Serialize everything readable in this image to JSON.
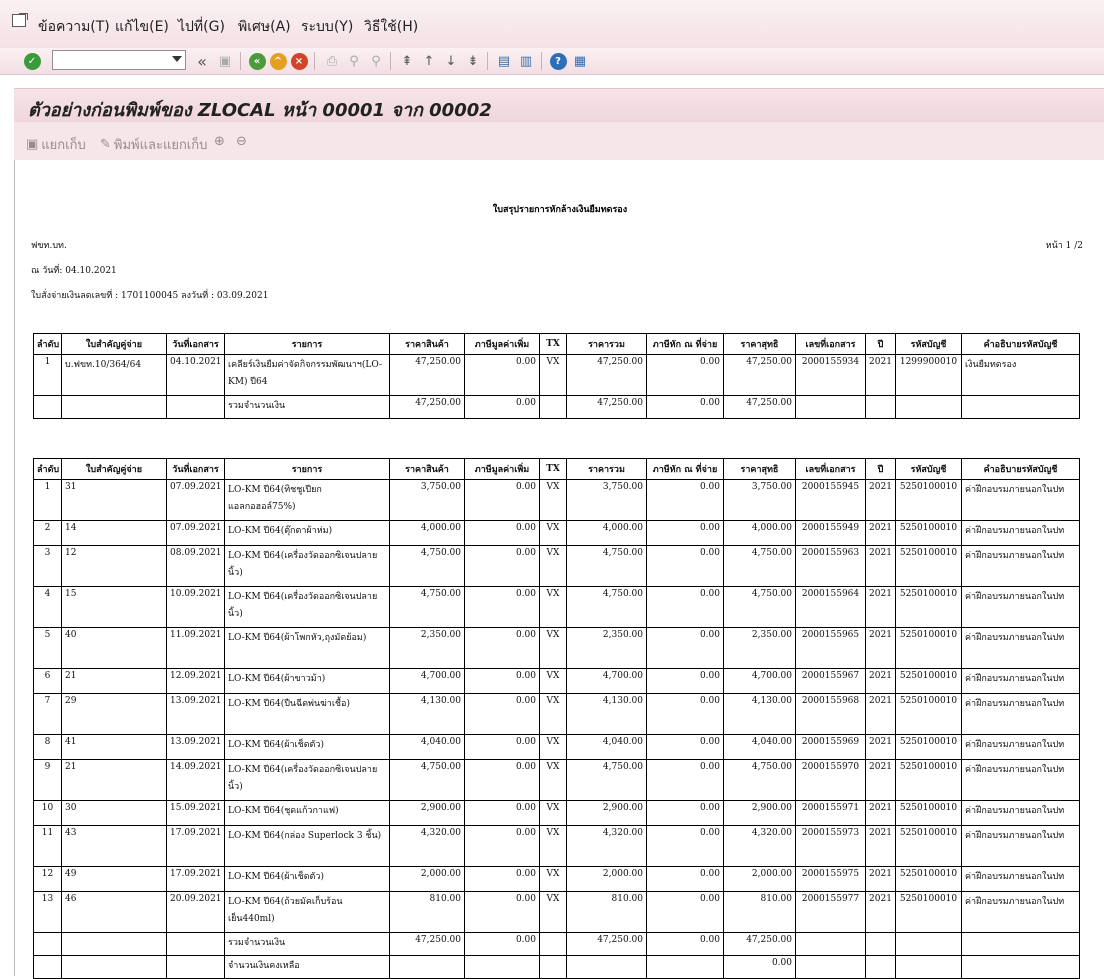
{
  "menu": [
    "ข้อความ(T)",
    "แก้ไข(E)",
    "ไปที่(G)",
    "พิเศษ(A)",
    "ระบบ(Y)",
    "วิธีใช้(H)"
  ],
  "title": "ตัวอย่างก่อนพิมพ์ของ ZLOCAL หน้า 00001 จาก 00002",
  "app_toolbar": {
    "spool": "แยกเก็บ",
    "print_spool": "พิมพ์และแยกเก็บ"
  },
  "report": {
    "heading": "ใบสรุปรายการหักล้างเงินยืมทดรอง",
    "org": "ฟขท.บท.",
    "page": "หน้า  1  /2",
    "date_line": "ณ วันที่:    04.10.2021",
    "order_line": "ใบสั่งจ่ายเงินลดเลขที่ : 1701100045    ลงวันที่ : 03.09.2021"
  },
  "columns": [
    "ลำดับ",
    "ใบสำคัญคู่จ่าย",
    "วันที่เอกสาร",
    "รายการ",
    "ราคาสินค้า",
    "ภาษีมูลค่าเพิ่ม",
    "TX",
    "ราคารวม",
    "ภาษีหัก ณ ที่จ่าย",
    "ราคาสุทธิ",
    "เลขที่เอกสาร",
    "ปี",
    "รหัสบัญชี",
    "คำอธิบายรหัสบัญชี"
  ],
  "table1": {
    "rows": [
      [
        "1",
        "บ.ฟขท.10/364/64",
        "04.10.2021",
        "เคลียร์เงินยืมค่าจัดกิจกรรมพัฒนาฯ(LO-KM)   ปี64",
        "47,250.00",
        "0.00",
        "VX",
        "47,250.00",
        "0.00",
        "47,250.00",
        "2000155934",
        "2021",
        "1299900010",
        "เงินยืมทดรอง"
      ]
    ],
    "total": {
      "label": "รวมจำนวนเงิน",
      "price": "47,250.00",
      "vat": "0.00",
      "gross": "47,250.00",
      "wht": "0.00",
      "net": "47,250.00"
    }
  },
  "table2": {
    "rows": [
      [
        "1",
        "31",
        "07.09.2021",
        "LO-KM    ปี64(ทิชชูเปียกแอลกอฮอล์75%)",
        "3,750.00",
        "0.00",
        "VX",
        "3,750.00",
        "0.00",
        "3,750.00",
        "2000155945",
        "2021",
        "5250100010",
        "ค่าฝึกอบรมภายนอกในปท"
      ],
      [
        "2",
        "14",
        "07.09.2021",
        "LO-KM    ปี64(ตุ๊กตาผ้าห่ม)",
        "4,000.00",
        "0.00",
        "VX",
        "4,000.00",
        "0.00",
        "4,000.00",
        "2000155949",
        "2021",
        "5250100010",
        "ค่าฝึกอบรมภายนอกในปท"
      ],
      [
        "3",
        "12",
        "08.09.2021",
        "LO-KM ปี64(เครื่องวัดออกซิเจนปลายนิ้ว)",
        "4,750.00",
        "0.00",
        "VX",
        "4,750.00",
        "0.00",
        "4,750.00",
        "2000155963",
        "2021",
        "5250100010",
        "ค่าฝึกอบรมภายนอกในปท"
      ],
      [
        "4",
        "15",
        "10.09.2021",
        "LO-KM ปี64(เครื่องวัดออกซิเจนปลายนิ้ว)",
        "4,750.00",
        "0.00",
        "VX",
        "4,750.00",
        "0.00",
        "4,750.00",
        "2000155964",
        "2021",
        "5250100010",
        "ค่าฝึกอบรมภายนอกในปท"
      ],
      [
        "5",
        "40",
        "11.09.2021",
        "LO-KM ปี64(ผ้าโพกหัว,ถุงมัดย้อม)",
        "2,350.00",
        "0.00",
        "VX",
        "2,350.00",
        "0.00",
        "2,350.00",
        "2000155965",
        "2021",
        "5250100010",
        "ค่าฝึกอบรมภายนอกในปท"
      ],
      [
        "6",
        "21",
        "12.09.2021",
        "LO-KM    ปี64(ผ้าขาวม้า)",
        "4,700.00",
        "0.00",
        "VX",
        "4,700.00",
        "0.00",
        "4,700.00",
        "2000155967",
        "2021",
        "5250100010",
        "ค่าฝึกอบรมภายนอกในปท"
      ],
      [
        "7",
        "29",
        "13.09.2021",
        "LO-KM    ปี64(ปืนฉีดพ่นฆ่าเชื้อ)",
        "4,130.00",
        "0.00",
        "VX",
        "4,130.00",
        "0.00",
        "4,130.00",
        "2000155968",
        "2021",
        "5250100010",
        "ค่าฝึกอบรมภายนอกในปท"
      ],
      [
        "8",
        "41",
        "13.09.2021",
        "LO-KM    ปี64(ผ้าเช็ดตัว)",
        "4,040.00",
        "0.00",
        "VX",
        "4,040.00",
        "0.00",
        "4,040.00",
        "2000155969",
        "2021",
        "5250100010",
        "ค่าฝึกอบรมภายนอกในปท"
      ],
      [
        "9",
        "21",
        "14.09.2021",
        "LO-KM ปี64(เครื่องวัดออกซิเจนปลายนิ้ว)",
        "4,750.00",
        "0.00",
        "VX",
        "4,750.00",
        "0.00",
        "4,750.00",
        "2000155970",
        "2021",
        "5250100010",
        "ค่าฝึกอบรมภายนอกในปท"
      ],
      [
        "10",
        "30",
        "15.09.2021",
        "LO-KM    ปี64(ชุดแก้วกาแฟ)",
        "2,900.00",
        "0.00",
        "VX",
        "2,900.00",
        "0.00",
        "2,900.00",
        "2000155971",
        "2021",
        "5250100010",
        "ค่าฝึกอบรมภายนอกในปท"
      ],
      [
        "11",
        "43",
        "17.09.2021",
        "LO-KM    ปี64(กล่อง Superlock    3 ชิ้น)",
        "4,320.00",
        "0.00",
        "VX",
        "4,320.00",
        "0.00",
        "4,320.00",
        "2000155973",
        "2021",
        "5250100010",
        "ค่าฝึกอบรมภายนอกในปท"
      ],
      [
        "12",
        "49",
        "17.09.2021",
        "LO-KM    ปี64(ผ้าเช็ดตัว)",
        "2,000.00",
        "0.00",
        "VX",
        "2,000.00",
        "0.00",
        "2,000.00",
        "2000155975",
        "2021",
        "5250100010",
        "ค่าฝึกอบรมภายนอกในปท"
      ],
      [
        "13",
        "46",
        "20.09.2021",
        "LO-KM    ปี64(ถ้วยมัคเก็บร้อนเย็น440ml)",
        "810.00",
        "0.00",
        "VX",
        "810.00",
        "0.00",
        "810.00",
        "2000155977",
        "2021",
        "5250100010",
        "ค่าฝึกอบรมภายนอกในปท"
      ]
    ],
    "total": {
      "label": "รวมจำนวนเงิน",
      "price": "47,250.00",
      "vat": "0.00",
      "gross": "47,250.00",
      "wht": "0.00",
      "net": "47,250.00"
    },
    "balance": {
      "label": "จำนวนเงินคงเหลือ",
      "net": "0.00"
    }
  }
}
